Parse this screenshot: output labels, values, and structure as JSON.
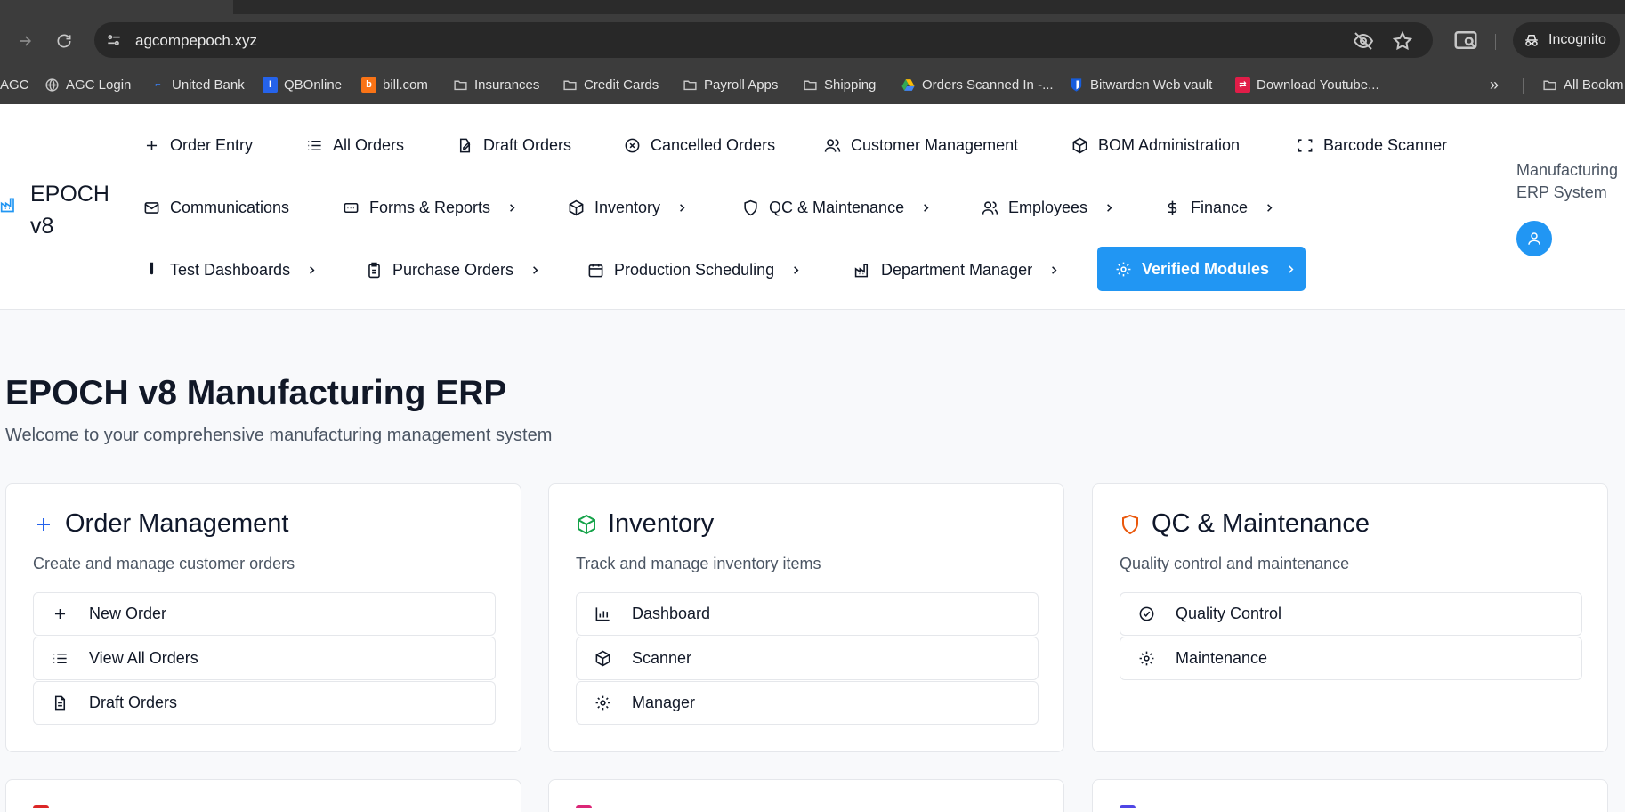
{
  "browser": {
    "url": "agcompepoch.xyz",
    "incognito_label": "Incognito",
    "bookmarks": [
      {
        "label": "AGC",
        "icon": "agc-icon"
      },
      {
        "label": "AGC Login",
        "icon": "globe-icon"
      },
      {
        "label": "United Bank",
        "icon": "bank-icon"
      },
      {
        "label": "QBOnline",
        "icon": "qb-icon"
      },
      {
        "label": "bill.com",
        "icon": "bill-icon"
      },
      {
        "label": "Insurances",
        "icon": "folder-icon"
      },
      {
        "label": "Credit Cards",
        "icon": "folder-icon"
      },
      {
        "label": "Payroll Apps",
        "icon": "folder-icon"
      },
      {
        "label": "Shipping",
        "icon": "folder-icon"
      },
      {
        "label": "Orders Scanned In -...",
        "icon": "drive-icon"
      },
      {
        "label": "Bitwarden Web vault",
        "icon": "bitwarden-icon"
      },
      {
        "label": "Download Youtube...",
        "icon": "youtube-icon"
      }
    ],
    "all_bookmarks_label": "All Bookm"
  },
  "app": {
    "brand": "EPOCH v8",
    "system_label": "Manufacturing ERP System",
    "nav_row1": [
      {
        "label": "Order Entry",
        "icon": "plus-icon"
      },
      {
        "label": "All Orders",
        "icon": "list-icon"
      },
      {
        "label": "Draft Orders",
        "icon": "edit-doc-icon"
      },
      {
        "label": "Cancelled Orders",
        "icon": "x-circle-icon"
      },
      {
        "label": "Customer Management",
        "icon": "users-icon"
      },
      {
        "label": "BOM Administration",
        "icon": "box-icon"
      },
      {
        "label": "Barcode Scanner",
        "icon": "scan-icon"
      }
    ],
    "nav_row2": [
      {
        "label": "Communications",
        "icon": "mail-icon"
      },
      {
        "label": "Forms & Reports",
        "icon": "card-icon"
      },
      {
        "label": "Inventory",
        "icon": "box-icon"
      },
      {
        "label": "QC & Maintenance",
        "icon": "shield-icon"
      },
      {
        "label": "Employees",
        "icon": "users-icon"
      },
      {
        "label": "Finance",
        "icon": "dollar-icon"
      }
    ],
    "nav_row3": [
      {
        "label": "Test Dashboards",
        "icon": "test-tube-icon"
      },
      {
        "label": "Purchase Orders",
        "icon": "clipboard-icon"
      },
      {
        "label": "Production Scheduling",
        "icon": "calendar-icon"
      },
      {
        "label": "Department Manager",
        "icon": "factory-icon"
      },
      {
        "label": "Verified Modules",
        "icon": "gear-icon"
      }
    ]
  },
  "main": {
    "title": "EPOCH v8 Manufacturing ERP",
    "subtitle": "Welcome to your comprehensive manufacturing management system",
    "cards": [
      {
        "title": "Order Management",
        "subtitle": "Create and manage customer orders",
        "icon": "plus-icon",
        "accent": "#2563eb",
        "buttons": [
          {
            "label": "New Order",
            "icon": "plus-icon"
          },
          {
            "label": "View All Orders",
            "icon": "list-icon"
          },
          {
            "label": "Draft Orders",
            "icon": "file-icon"
          }
        ]
      },
      {
        "title": "Inventory",
        "subtitle": "Track and manage inventory items",
        "icon": "box-icon",
        "accent": "#16a34a",
        "buttons": [
          {
            "label": "Dashboard",
            "icon": "bar-chart-icon"
          },
          {
            "label": "Scanner",
            "icon": "box-icon"
          },
          {
            "label": "Manager",
            "icon": "gear-icon"
          }
        ]
      },
      {
        "title": "QC & Maintenance",
        "subtitle": "Quality control and maintenance",
        "icon": "shield-icon",
        "accent": "#ea580c",
        "buttons": [
          {
            "label": "Quality Control",
            "icon": "check-circle-icon"
          },
          {
            "label": "Maintenance",
            "icon": "gear-icon"
          }
        ]
      }
    ],
    "bottom_card_accents": [
      "#dc2626",
      "#db2777",
      "#4f46e5"
    ]
  },
  "colors": {
    "primary": "#2196f3",
    "chrome_bg": "#3c3c3c",
    "page_bg": "#f8f9fb"
  }
}
